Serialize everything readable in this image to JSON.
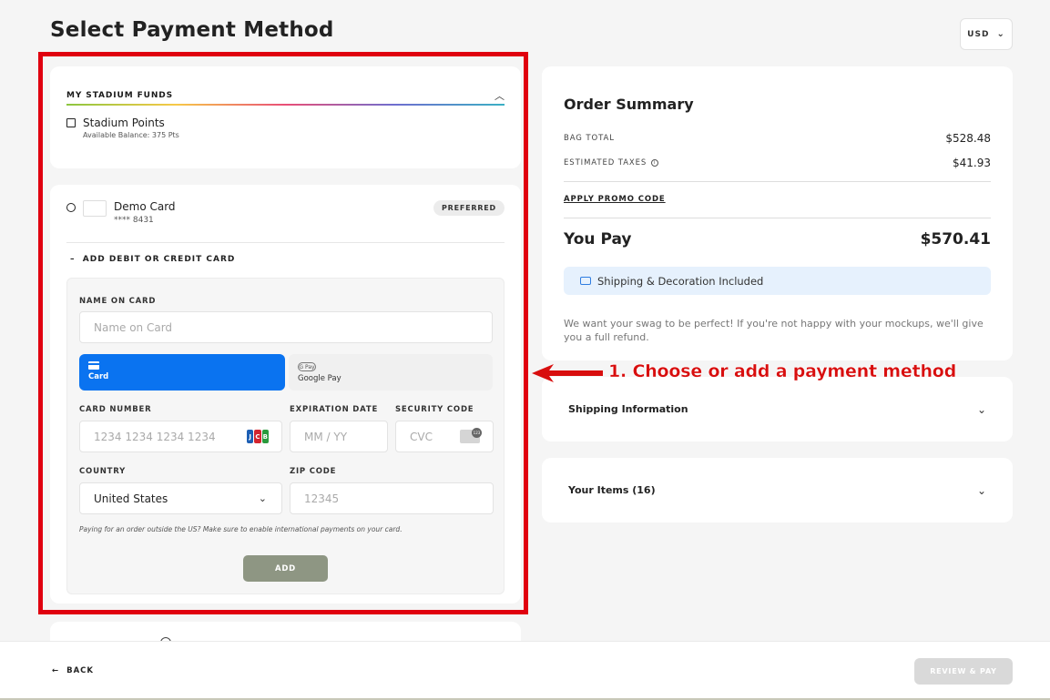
{
  "page": {
    "title": "Select Payment Method"
  },
  "currency": {
    "value": "USD"
  },
  "funds": {
    "title": "MY STADIUM FUNDS",
    "points_label": "Stadium Points",
    "points_balance": "Available Balance: 375 Pts"
  },
  "saved_card": {
    "name": "Demo Card",
    "number": "**** 8431",
    "badge": "PREFERRED"
  },
  "add_card": {
    "toggle_label": "ADD DEBIT OR CREDIT CARD",
    "name_label": "NAME ON CARD",
    "name_placeholder": "Name on Card",
    "tabs": {
      "card": "Card",
      "gpay": "Google Pay",
      "gpay_icon": "G Pay"
    },
    "card_number_label": "CARD NUMBER",
    "card_number_placeholder": "1234 1234 1234 1234",
    "expiry_label": "EXPIRATION DATE",
    "expiry_placeholder": "MM / YY",
    "cvc_label": "SECURITY CODE",
    "cvc_placeholder": "CVC",
    "country_label": "COUNTRY",
    "country_value": "United States",
    "zip_label": "ZIP CODE",
    "zip_placeholder": "12345",
    "note": "Paying for an order outside the US? Make sure to enable international payments on your card.",
    "add_button": "ADD",
    "jcb": [
      "J",
      "C",
      "B"
    ]
  },
  "summary": {
    "title": "Order Summary",
    "bag_total_label": "BAG TOTAL",
    "bag_total": "$528.48",
    "taxes_label": "ESTIMATED TAXES",
    "taxes": "$41.93",
    "promo": "APPLY PROMO CODE",
    "you_pay_label": "You Pay",
    "you_pay": "$570.41",
    "shipping_banner": "Shipping & Decoration Included",
    "guarantee": "We want your swag to be perfect! If you're not happy with your mockups, we'll give you a full refund."
  },
  "accordions": {
    "shipping": "Shipping Information",
    "items": "Your Items (16)"
  },
  "annotation": {
    "text": "1. Choose or add a payment method",
    "color": "#d80e0e"
  },
  "footer": {
    "back": "BACK",
    "review": "REVIEW & PAY"
  },
  "colors": {
    "primary": "#0a73f0",
    "highlight": "#e0000f",
    "add_button": "#8e9683"
  }
}
